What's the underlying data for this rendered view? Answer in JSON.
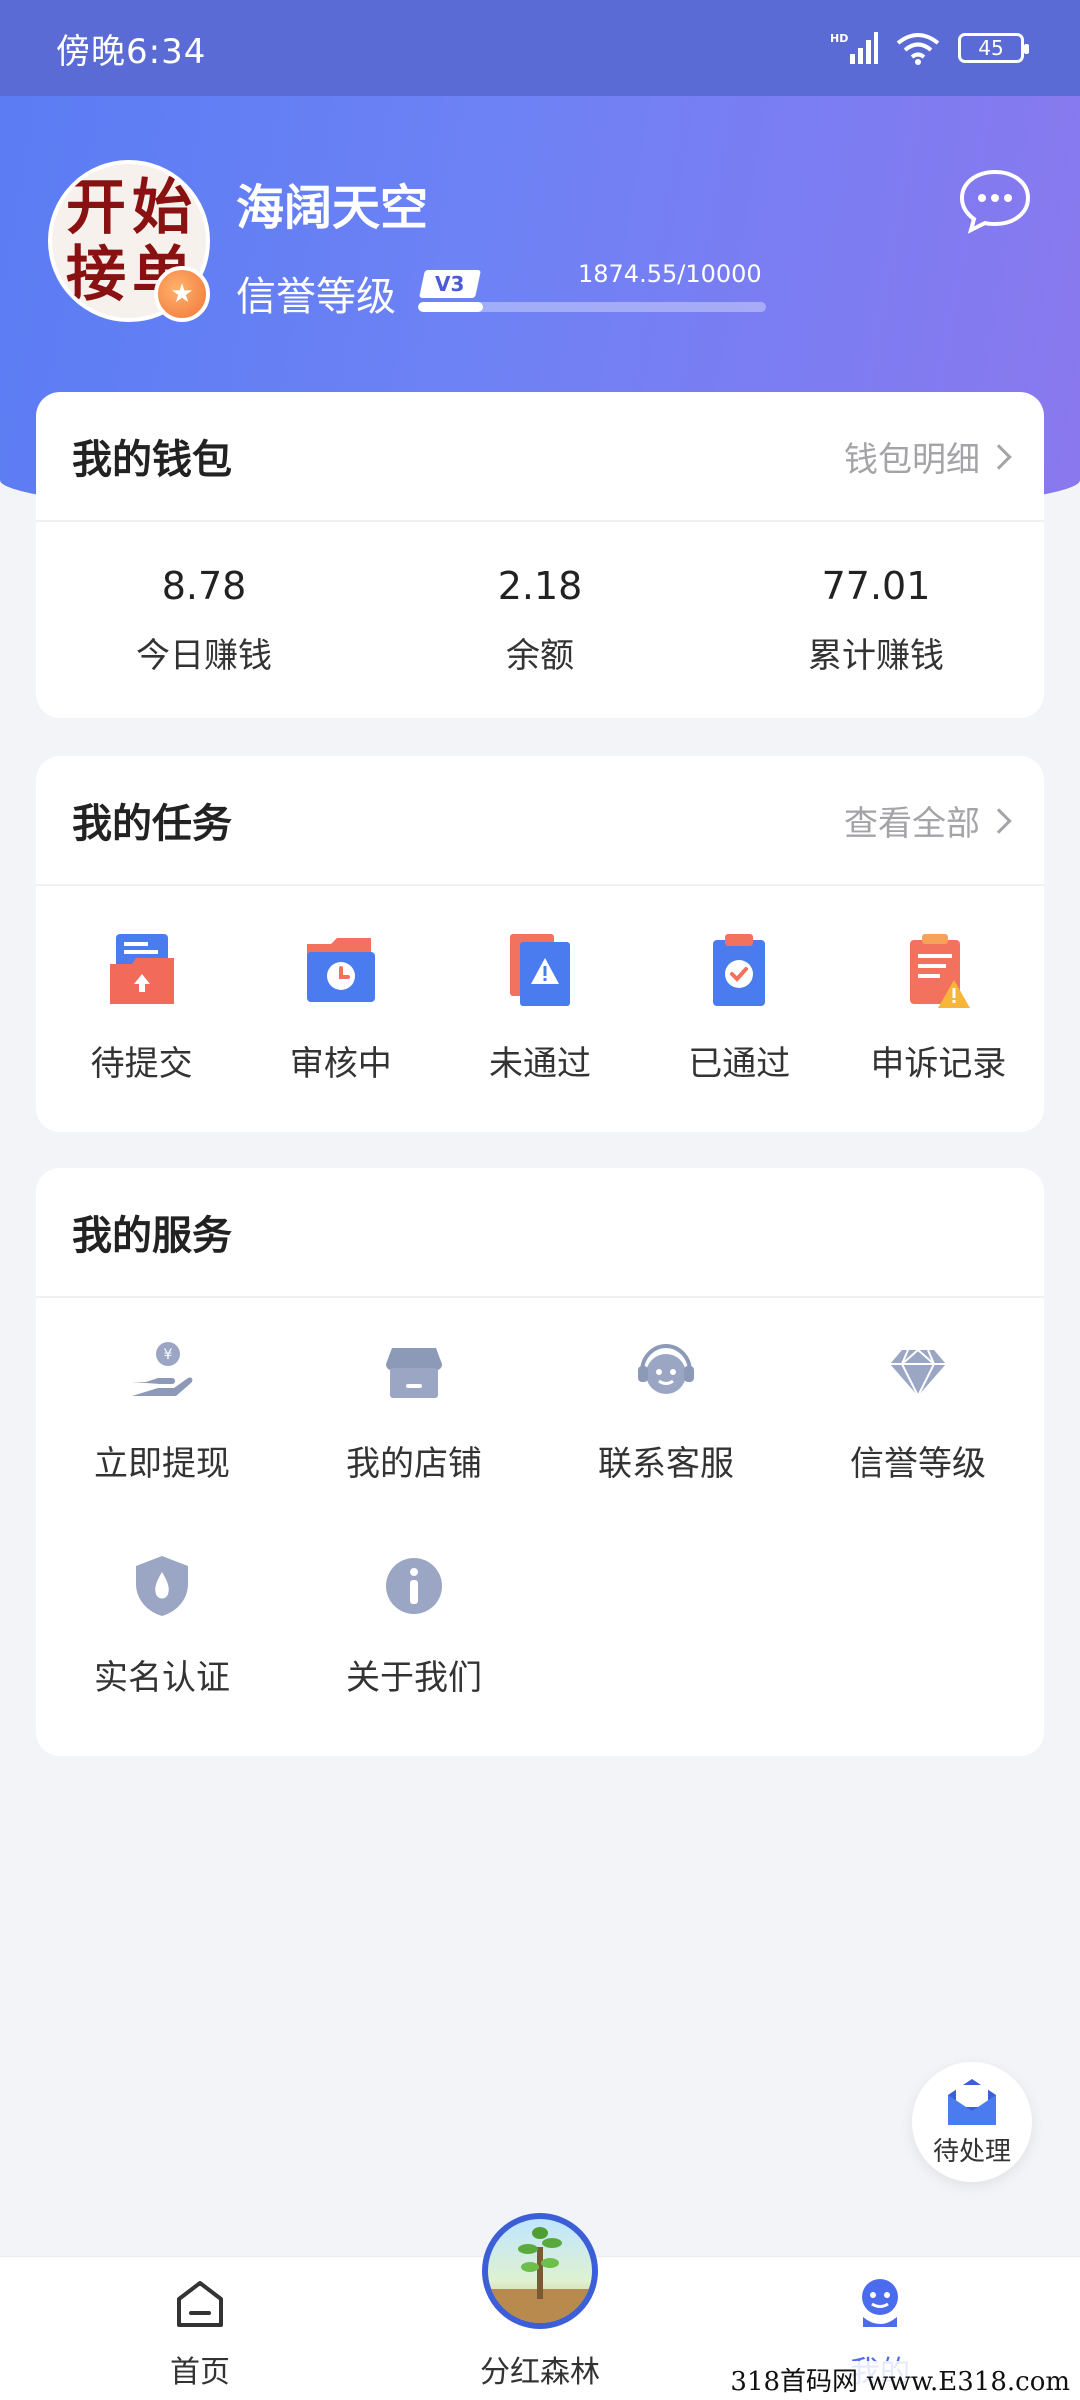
{
  "status_bar": {
    "time": "傍晚6:34",
    "network": "HD",
    "battery": "45"
  },
  "profile": {
    "avatar_text": [
      "开",
      "始",
      "接",
      "单"
    ],
    "username": "海阔天空",
    "credit_label": "信誉等级",
    "level": "V3",
    "score": "1874.55/10000",
    "score_progress": 0.187
  },
  "wallet": {
    "title": "我的钱包",
    "more": "钱包明细",
    "items": [
      {
        "value": "8.78",
        "label": "今日赚钱"
      },
      {
        "value": "2.18",
        "label": "余额"
      },
      {
        "value": "77.01",
        "label": "累计赚钱"
      }
    ]
  },
  "tasks": {
    "title": "我的任务",
    "more": "查看全部",
    "items": [
      {
        "label": "待提交",
        "icon": "folder-upload-icon"
      },
      {
        "label": "审核中",
        "icon": "folder-clock-icon"
      },
      {
        "label": "未通过",
        "icon": "document-warning-icon"
      },
      {
        "label": "已通过",
        "icon": "clipboard-check-icon"
      },
      {
        "label": "申诉记录",
        "icon": "report-warning-icon"
      }
    ]
  },
  "services": {
    "title": "我的服务",
    "items": [
      {
        "label": "立即提现",
        "icon": "withdraw-icon"
      },
      {
        "label": "我的店铺",
        "icon": "shop-icon"
      },
      {
        "label": "联系客服",
        "icon": "customer-service-icon"
      },
      {
        "label": "信誉等级",
        "icon": "diamond-icon"
      },
      {
        "label": "实名认证",
        "icon": "shield-icon"
      },
      {
        "label": "关于我们",
        "icon": "info-icon"
      }
    ]
  },
  "fab": {
    "label": "待处理"
  },
  "tabbar": {
    "home": "首页",
    "forest": "分红森林",
    "mine": "我的"
  },
  "watermark": "318首码网 www.E318.com",
  "colors": {
    "accent": "#4c6cf0",
    "header_start": "#5a7cf3",
    "header_end": "#8a78ee"
  }
}
